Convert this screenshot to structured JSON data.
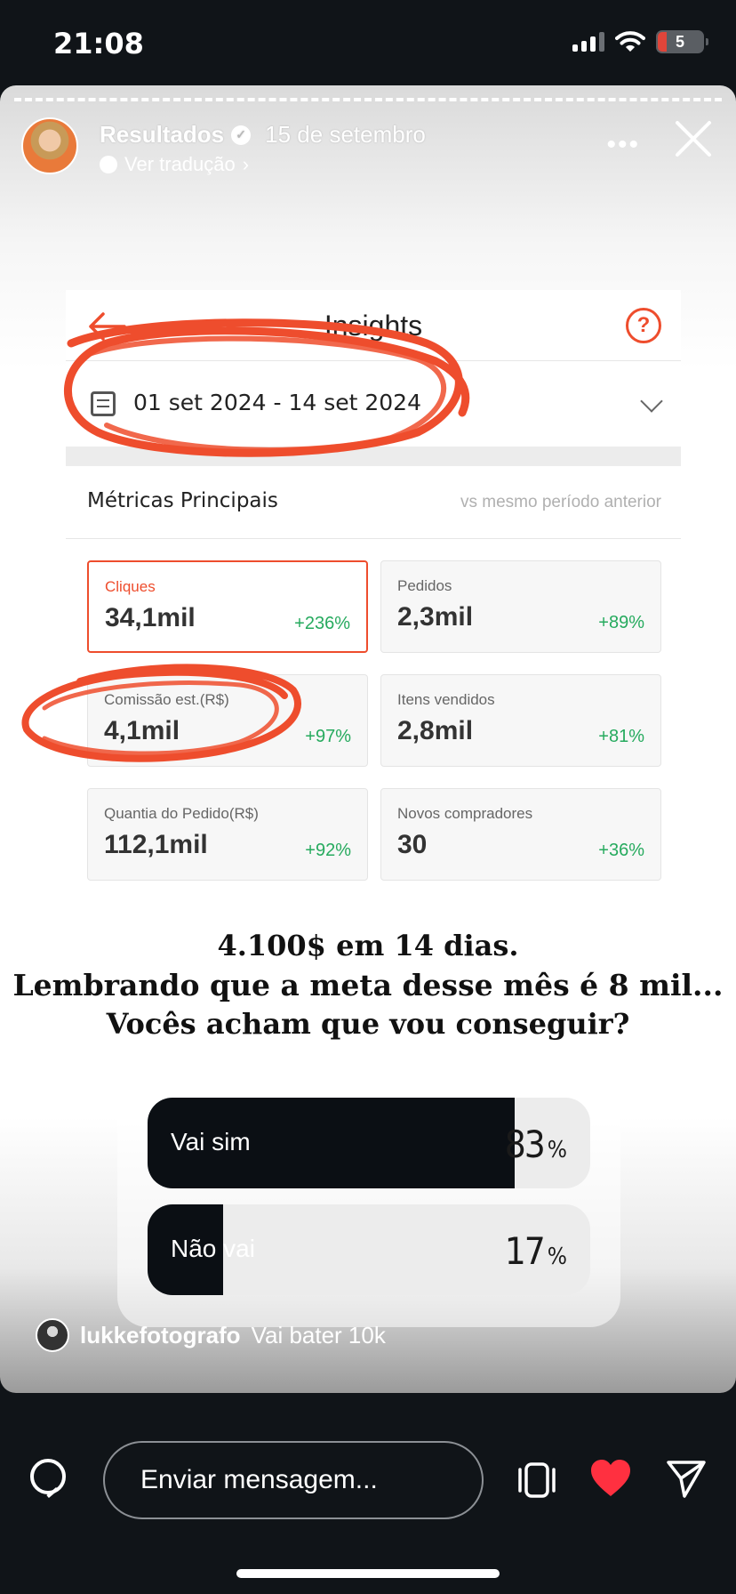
{
  "status_bar": {
    "time": "21:08",
    "battery": "5"
  },
  "story": {
    "username": "Resultados",
    "date": "15 de setembro",
    "translate_label": "Ver tradução"
  },
  "insights": {
    "title": "Insights",
    "help": "?",
    "date_range": "01 set 2024 - 14 set 2024",
    "section_title": "Métricas Principais",
    "comparison": "vs mesmo período anterior",
    "metrics": [
      {
        "label": "Cliques",
        "value": "34,1mil",
        "delta": "+236%"
      },
      {
        "label": "Pedidos",
        "value": "2,3mil",
        "delta": "+89%"
      },
      {
        "label": "Comissão est.(R$)",
        "value": "4,1mil",
        "delta": "+97%"
      },
      {
        "label": "Itens vendidos",
        "value": "2,8mil",
        "delta": "+81%"
      },
      {
        "label": "Quantia do Pedido(R$)",
        "value": "112,1mil",
        "delta": "+92%"
      },
      {
        "label": "Novos compradores",
        "value": "30",
        "delta": "+36%"
      }
    ]
  },
  "caption": {
    "line1": "4.100$ em 14 dias.",
    "line2": "Lembrando que a meta desse mês é 8 mil...",
    "line3": "Vocês acham que vou conseguir?"
  },
  "poll": {
    "options": [
      {
        "label": "Vai sim",
        "percent": "83",
        "fill_fraction": 0.83
      },
      {
        "label": "Não vai",
        "percent": "17",
        "fill_fraction": 0.17
      }
    ],
    "percent_symbol": "%"
  },
  "comment": {
    "user": "lukkefotografo",
    "text": "Vai bater 10k"
  },
  "bottom": {
    "placeholder": "Enviar mensagem..."
  },
  "colors": {
    "accent": "#ee4d2d",
    "positive": "#26aa5e",
    "heart": "#ff3040",
    "dark": "#101418"
  }
}
